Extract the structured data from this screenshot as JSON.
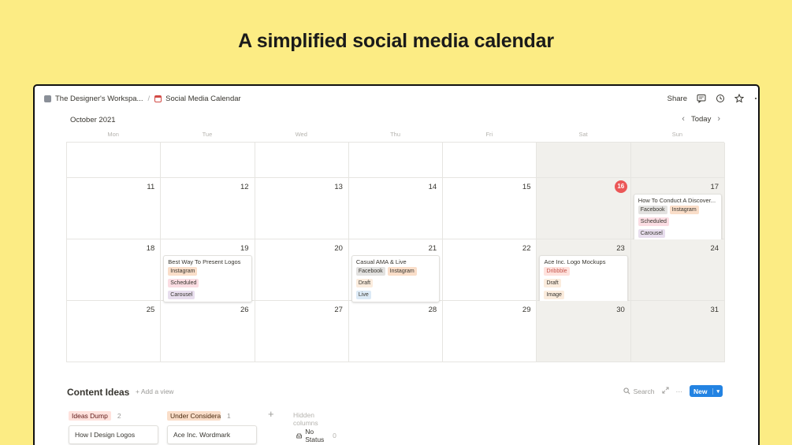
{
  "headline": "A simplified social media calendar",
  "topbar": {
    "workspace": "The Designer's Workspa...",
    "separator": "/",
    "page": "Social Media Calendar",
    "share": "Share"
  },
  "calendar": {
    "month_label": "October 2021",
    "today_label": "Today",
    "weekdays": [
      "Mon",
      "Tue",
      "Wed",
      "Thu",
      "Fri",
      "Sat",
      "Sun"
    ],
    "weeks": [
      [
        {
          "day": ""
        },
        {
          "day": ""
        },
        {
          "day": ""
        },
        {
          "day": ""
        },
        {
          "day": ""
        },
        {
          "day": "",
          "weekend": true
        },
        {
          "day": "",
          "weekend": true
        }
      ],
      [
        {
          "day": "11"
        },
        {
          "day": "12"
        },
        {
          "day": "13"
        },
        {
          "day": "14"
        },
        {
          "day": "15"
        },
        {
          "day": "16",
          "weekend": true,
          "today": true
        },
        {
          "day": "17",
          "weekend": true,
          "card": {
            "title": "How To Conduct A Discover...",
            "tags": [
              "Facebook",
              "Instagram",
              "Scheduled",
              "Carousel"
            ]
          }
        }
      ],
      [
        {
          "day": "18"
        },
        {
          "day": "19",
          "card": {
            "title": "Best Way To Present Logos",
            "tags": [
              "Instagram",
              "Scheduled",
              "Carousel"
            ]
          }
        },
        {
          "day": "20"
        },
        {
          "day": "21",
          "card": {
            "title": "Casual AMA & Live",
            "tags": [
              "Facebook",
              "Instagram",
              "Draft",
              "Live"
            ]
          }
        },
        {
          "day": "22"
        },
        {
          "day": "23",
          "weekend": true,
          "card": {
            "title": "Ace Inc. Logo Mockups",
            "tags": [
              "Dribbble",
              "Draft",
              "Image"
            ]
          }
        },
        {
          "day": "24",
          "weekend": true
        }
      ],
      [
        {
          "day": "25"
        },
        {
          "day": "26"
        },
        {
          "day": "27"
        },
        {
          "day": "28"
        },
        {
          "day": "29"
        },
        {
          "day": "30",
          "weekend": true
        },
        {
          "day": "31",
          "weekend": true
        }
      ]
    ]
  },
  "content_ideas": {
    "title": "Content Ideas",
    "add_view": "+ Add a view",
    "search": "Search",
    "new_label": "New",
    "groups": [
      {
        "label": "Ideas Dump",
        "count": "2",
        "cards": [
          "How I Design Logos"
        ]
      },
      {
        "label": "Under Considera",
        "count": "1",
        "cards": [
          "Ace Inc. Wordmark"
        ]
      }
    ],
    "hidden_columns": "Hidden columns",
    "no_status": {
      "label": "No Status",
      "count": "0"
    }
  },
  "colors": {
    "background": "#fcec84",
    "today_badge": "#eb5757",
    "new_button": "#2383e2"
  }
}
